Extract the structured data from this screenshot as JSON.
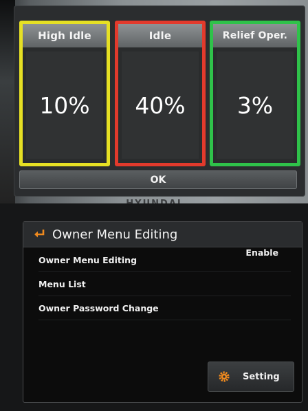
{
  "ratio_panel": {
    "cards": [
      {
        "label": "High Idle",
        "value": "10%",
        "border_color": "#e6e024"
      },
      {
        "label": "Idle",
        "value": "40%",
        "border_color": "#e23a2c"
      },
      {
        "label": "Relief Oper.",
        "value": "3%",
        "border_color": "#2fc24a"
      }
    ],
    "ok_label": "OK"
  },
  "brand": "HYUNDAI",
  "owner_menu": {
    "title": "Owner Menu Editing",
    "header_icon": "return-arrow-icon",
    "items": [
      {
        "label": "Owner Menu Editing",
        "value": "Enable"
      },
      {
        "label": "Menu List"
      },
      {
        "label": "Owner Password Change"
      }
    ],
    "setting_button": {
      "label": "Setting",
      "icon": "gear-icon",
      "icon_color": "#f08a1e"
    }
  }
}
